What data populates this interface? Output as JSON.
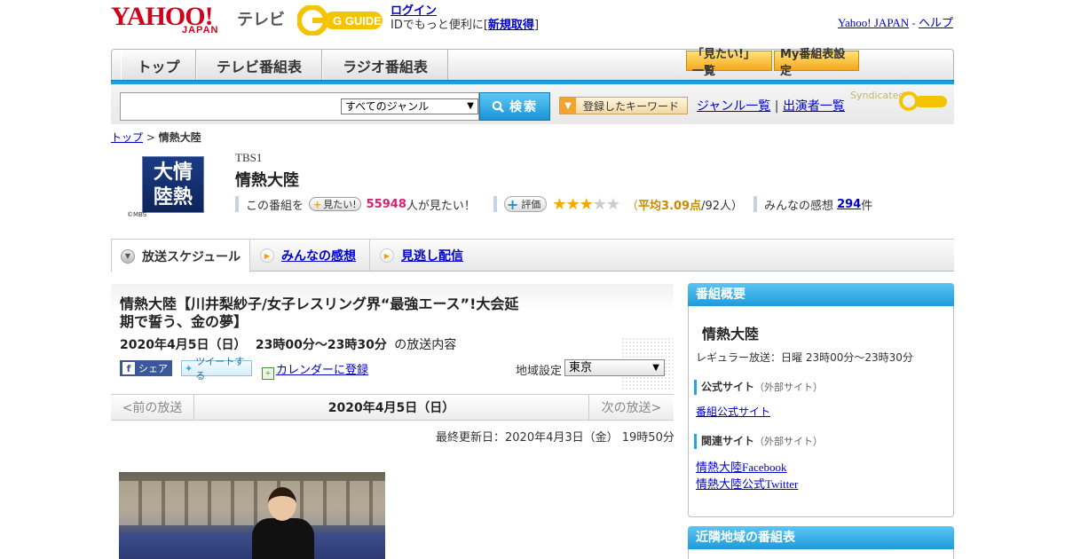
{
  "header": {
    "logo_main": "YAHOO!",
    "logo_sub": "JAPAN",
    "logo_tv": "テレビ",
    "gguide_label": "G GUIDE",
    "login_label": "ログイン",
    "login_text_prefix": "IDでもっと便利に[",
    "register_label": "新規取得",
    "login_text_suffix": "]",
    "yahoo_japan_link": "Yahoo! JAPAN",
    "separator": "-",
    "help_link": "ヘルプ"
  },
  "nav": {
    "tabs": [
      "トップ",
      "テレビ番組表",
      "ラジオ番組表"
    ],
    "mitai_list": "「見たい!」一覧",
    "my_schedule": "My番組表設定"
  },
  "search": {
    "placeholder": "",
    "genre_selected": "すべてのジャンル",
    "search_button": "検索",
    "keyword_button": "登録したキーワード",
    "genre_list_link": "ジャンル一覧",
    "divider": "|",
    "cast_list_link": "出演者一覧",
    "syndicated": "Syndicated"
  },
  "breadcrumb": {
    "top": "トップ",
    "sep": ">",
    "current": "情熱大陸"
  },
  "program": {
    "thumb_text_1": "大情",
    "thumb_text_2": "陸熱",
    "copyright": "©MBS",
    "channel": "TBS1",
    "title": "情熱大陸",
    "want_prefix": "この番組を",
    "want_button": "見たい!",
    "want_count": "55948",
    "want_suffix": "人が見たい！",
    "rating_button": "評価",
    "rating_stars": 3,
    "rating_max": 5,
    "avg_prefix": "（",
    "avg_label": "平均3.09点",
    "avg_suffix": "/92人）",
    "reviews_prefix": "みんなの感想",
    "reviews_count": "294",
    "reviews_suffix": "件"
  },
  "tabs": {
    "schedule": "放送スケジュール",
    "reviews": "みんなの感想",
    "missed": "見逃し配信"
  },
  "episode": {
    "title": "情熱大陸【川井梨紗子/女子レスリング界“最強エース”!大会延期で誓う、金の夢】",
    "date": "2020年4月5日（日）",
    "time": "23時00分～23時30分",
    "date_suffix": "の放送内容",
    "share_fb": "シェア",
    "share_tw": "ツイートする",
    "calendar_link": "カレンダーに登録",
    "region_label": "地域設定",
    "region_selected": "東京",
    "prev": "<前の放送",
    "current_date": "2020年4月5日（日）",
    "next": "次の放送>",
    "updated": "最終更新日：2020年4月3日（金） 19時50分"
  },
  "sidebar": {
    "overview_title": "番組概要",
    "program_name": "情熱大陸",
    "regular": "レギュラー放送：日曜 23時00分～23時30分",
    "official_label": "公式サイト",
    "external": "（外部サイト）",
    "official_link": "番組公式サイト",
    "related_label": "関連サイト",
    "related_links": [
      "情熱大陸Facebook",
      "情熱大陸公式Twitter"
    ],
    "nearby_title": "近隣地域の番組表"
  },
  "colors": {
    "accent_blue": "#1e9fdc",
    "yahoo_red": "#d0021b",
    "gguide_yellow": "#f5c400",
    "want_pink": "#d6246e"
  }
}
